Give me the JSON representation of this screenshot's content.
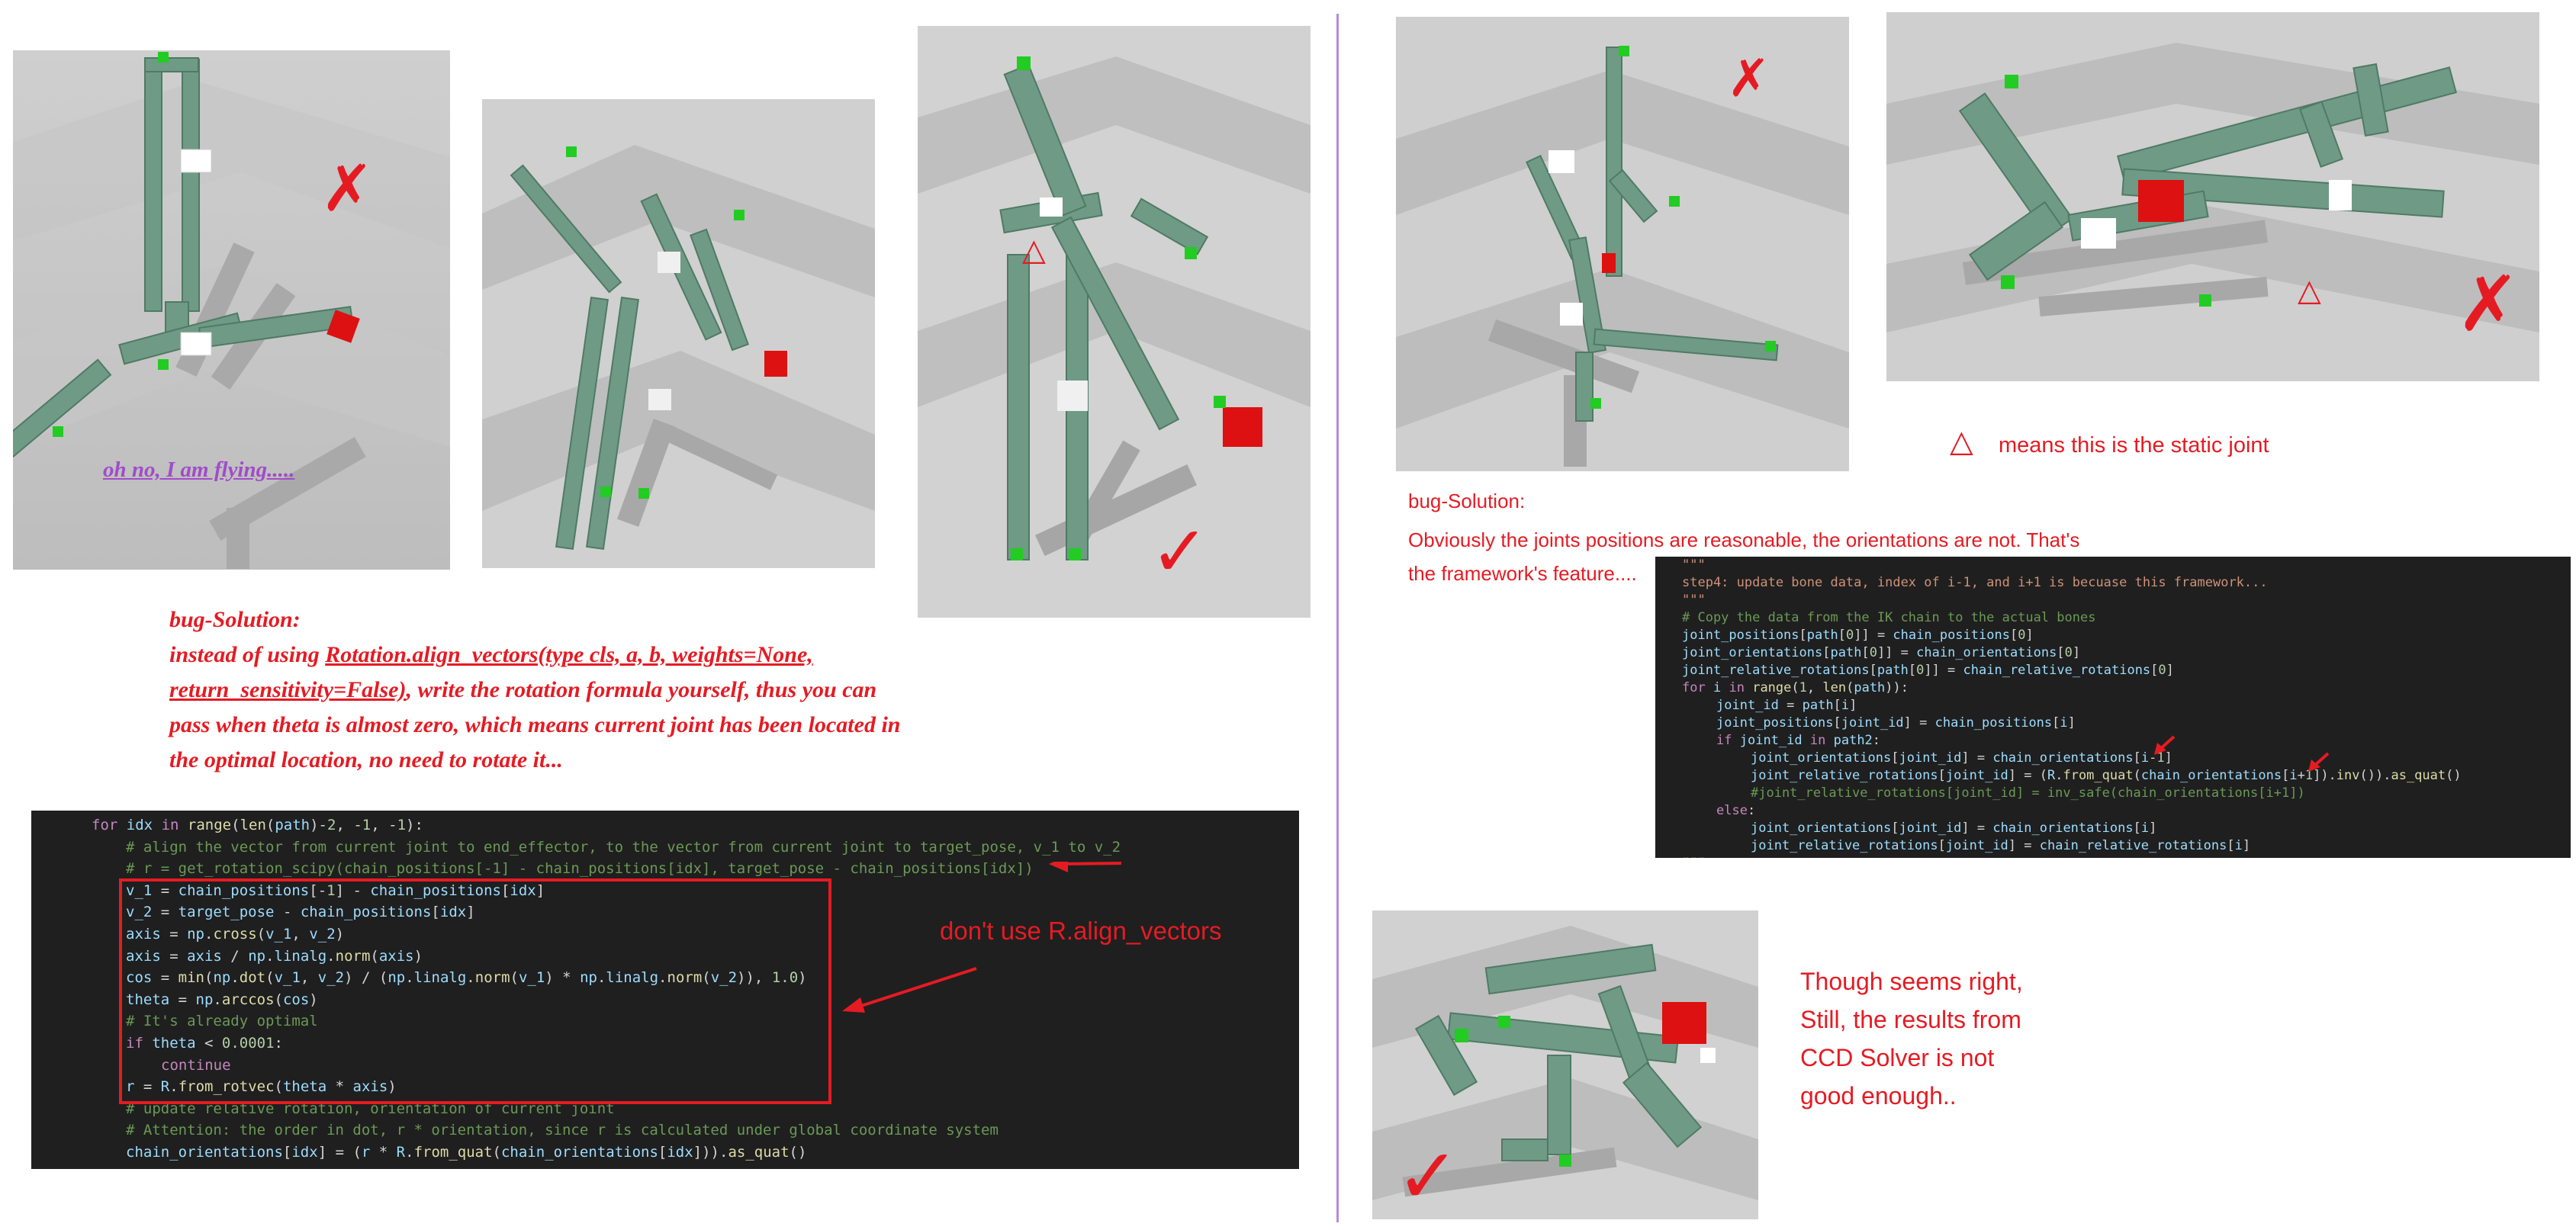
{
  "annotations": {
    "flying": "oh no, I am flying.....",
    "cross_mark": "✗",
    "check_mark": "✓",
    "triangle_mark": "△",
    "static_joint_note": "means this is the static joint",
    "dont_use_note": "don't use R.align_vectors",
    "though_lines": [
      "Though seems right,",
      "Still, the results from",
      "CCD Solver is not",
      "good enough.."
    ]
  },
  "left_solution": {
    "title": "bug-Solution:",
    "line1_prefix": "instead of  using  ",
    "line1_code": "Rotation.align_vectors(type cls, a, b, weights=None,",
    "line2_code": "return_sensitivity=False)",
    "line2_rest": ", write the rotation formula yourself, thus you can",
    "line3": "pass when theta is almost zero, which means current joint has been located in",
    "line4": "the optimal location, no need to rotate it..."
  },
  "right_solution": {
    "title": "bug-Solution:",
    "line1": "Obviously the joints positions are reasonable, the orientations are not. That's",
    "line2": "the framework's feature...."
  },
  "left_code": [
    "for idx in range(len(path)-2, -1, -1):",
    "    # align the vector from current joint to end_effector, to the vector from current joint to target_pose, v_1 to v_2",
    "    # r = get_rotation_scipy(chain_positions[-1] - chain_positions[idx], target_pose - chain_positions[idx])",
    "    v_1 = chain_positions[-1] - chain_positions[idx]",
    "    v_2 = target_pose - chain_positions[idx]",
    "    axis = np.cross(v_1, v_2)",
    "    axis = axis / np.linalg.norm(axis)",
    "    cos = min(np.dot(v_1, v_2) / (np.linalg.norm(v_1) * np.linalg.norm(v_2)), 1.0)",
    "    theta = np.arccos(cos)",
    "    # It's already optimal",
    "    if theta < 0.0001:",
    "        continue",
    "    r = R.from_rotvec(theta * axis)",
    "    # update relative rotation, orientation of current joint",
    "    # Attention: the order in dot, r * orientation, since r is calculated under global coordinate system",
    "    chain_orientations[idx] = (r * R.from_quat(chain_orientations[idx])).as_quat()"
  ],
  "right_code": [
    "\"\"\"",
    "step4: update bone data, index of i-1, and i+1 is becuase this framework...",
    "\"\"\"",
    "# Copy the data from the IK chain to the actual bones",
    "joint_positions[path[0]] = chain_positions[0]",
    "joint_orientations[path[0]] = chain_orientations[0]",
    "joint_relative_rotations[path[0]] = chain_relative_rotations[0]",
    "for i in range(1, len(path)):",
    "    joint_id = path[i]",
    "    joint_positions[joint_id] = chain_positions[i]",
    "    if joint_id in path2:",
    "        joint_orientations[joint_id] = chain_orientations[i-1]",
    "        joint_relative_rotations[joint_id] = (R.from_quat(chain_orientations[i+1]).inv()).as_quat()",
    "        #joint_relative_rotations[joint_id] = inv_safe(chain_orientations[i+1])",
    "    else:",
    "        joint_orientations[joint_id] = chain_orientations[i]",
    "        joint_relative_rotations[joint_id] = chain_relative_rotations[i]",
    "\"\"\""
  ],
  "colors": {
    "annotation_red": "#e51b23",
    "flying_purple": "#a14cc9",
    "divider": "#b98ad6",
    "bone_green": "#6f9a86",
    "target_red": "#dd1111",
    "effector_green": "#22cc22",
    "code_bg": "#1f1f1f"
  }
}
